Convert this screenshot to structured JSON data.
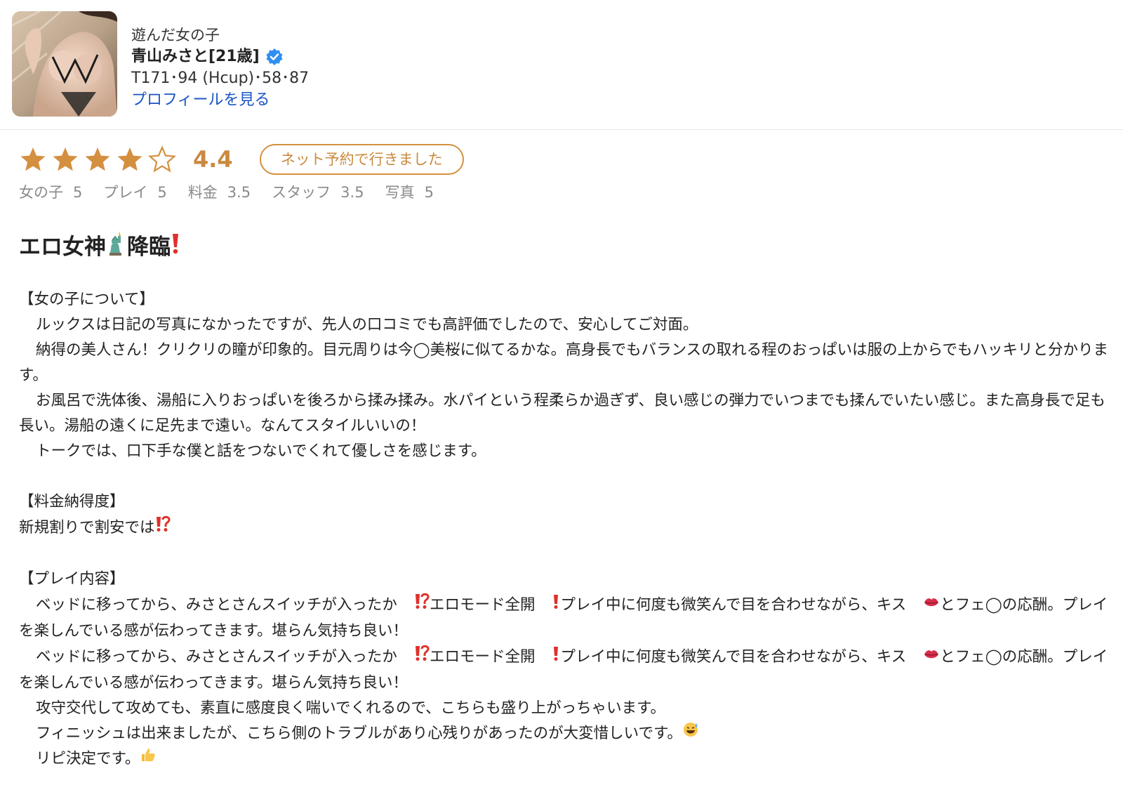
{
  "header": {
    "label": "遊んだ女の子",
    "name": "青山みさと[21歳]",
    "stats": "T171･94 (Hcup)･58･87",
    "profile_link": "プロフィールを見る"
  },
  "rating": {
    "score": "4.4",
    "stars": 4.4,
    "max_stars": 5,
    "badge": "ネット予約で行きました",
    "star_color": "#d4903f",
    "subratings": [
      {
        "label": "女の子",
        "value": "5"
      },
      {
        "label": "プレイ",
        "value": "5"
      },
      {
        "label": "料金",
        "value": "3.5"
      },
      {
        "label": "スタッフ",
        "value": "3.5"
      },
      {
        "label": "写真",
        "value": "5"
      }
    ]
  },
  "review": {
    "title_a": "エロ女神",
    "title_b": "降臨",
    "title_emoji_1": "statue-of-liberty-icon",
    "title_emoji_2": "exclamation-icon",
    "s1_head": "【女の子について】",
    "s1_p1": "ルックスは日記の写真になかったですが、先人の口コミでも高評価でしたので、安心してご対面。",
    "s1_p2": "納得の美人さん！クリクリの瞳が印象的。目元周りは今◯美桜に似てるかな。高身長でもバランスの取れる程のおっぱいは服の上からでもハッキリと分かります。",
    "s1_p3": "お風呂で洗体後、湯船に入りおっぱいを後ろから揉み揉み。水パイという程柔らか過ぎず、良い感じの弾力でいつまでも揉んでいたい感じ。また高身長で足も長い。湯船の遠くに足先まで遠い。なんてスタイルいいの！",
    "s1_p4": "トークでは、口下手な僕と話をつないでくれて優しさを感じます。",
    "s2_head": "【料金納得度】",
    "s2_p1": "新規割りで割安では",
    "s3_head": "【プレイ内容】",
    "s3_p1a": "ベッドに移ってから、みさとさんスイッチが入ったか",
    "s3_p1b": "エロモード全開",
    "s3_p1c": "プレイ中に何度も微笑んで目を合わせながら、キス",
    "s3_p1d": "とフェ◯の応酬。プレイを楽しんでいる感が伝わってきます。堪らん気持ち良い！",
    "s3_p3": "攻守交代して攻めても、素直に感度良く喘いでくれるので、こちらも盛り上がっちゃいます。",
    "s3_p4": "フィニッシュは出来ましたが、こちら側のトラブルがあり心残りがあったのが大変惜しいです。",
    "s3_p5": "リピ決定です。"
  }
}
